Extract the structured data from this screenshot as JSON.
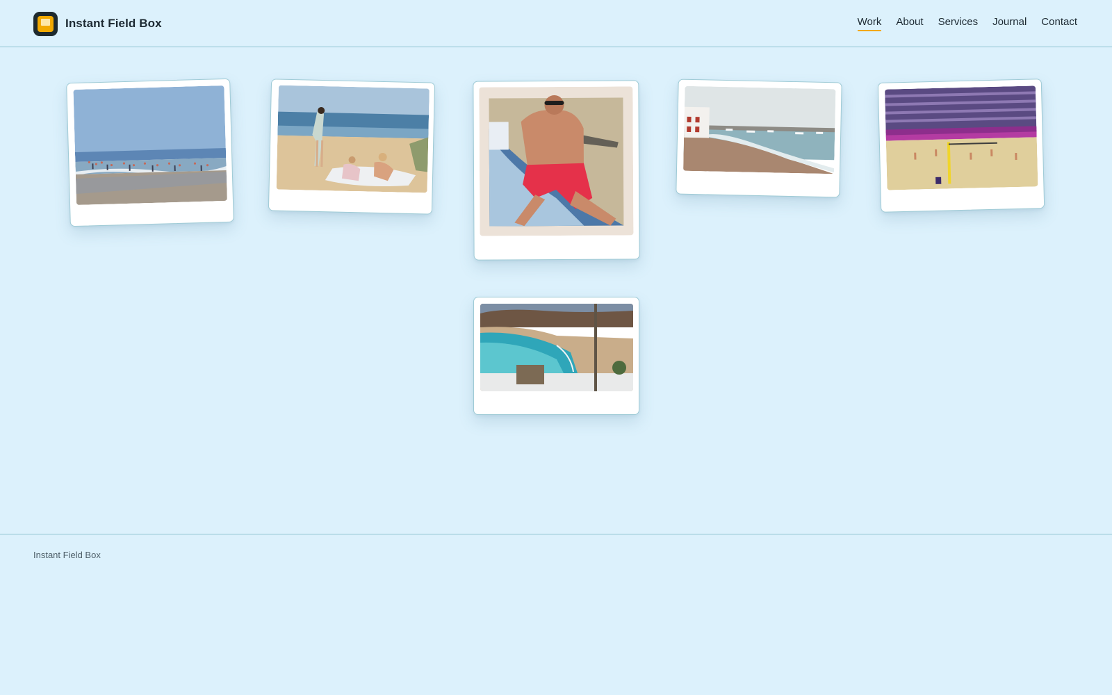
{
  "brand": {
    "name": "Instant Field Box",
    "logo_icon": "instant-camera-icon"
  },
  "nav": {
    "items": [
      {
        "label": "Work",
        "active": true
      },
      {
        "label": "About",
        "active": false
      },
      {
        "label": "Services",
        "active": false
      },
      {
        "label": "Journal",
        "active": false
      },
      {
        "label": "Contact",
        "active": false
      }
    ]
  },
  "gallery": {
    "photos": [
      {
        "subject": "crowded beach shoreline with swimmers"
      },
      {
        "subject": "painting of girl and children on a sandy beach"
      },
      {
        "subject": "man in red swim shorts sitting on a towel"
      },
      {
        "subject": "harbour beach with boats and white buildings"
      },
      {
        "subject": "beach volleyball match in a stadium"
      },
      {
        "subject": "cove with turquoise water and sandy beach"
      }
    ]
  },
  "footer": {
    "text": "Instant Field Box"
  },
  "colors": {
    "background": "#dcf1fc",
    "accent": "#f2a900",
    "border": "#8ec2cf"
  }
}
